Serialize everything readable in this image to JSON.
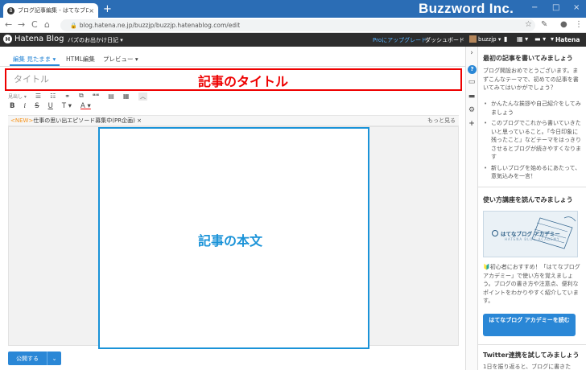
{
  "browser": {
    "tab_title": "ブログ記事編集 - はてなブログ",
    "tab_close": "×",
    "new_tab": "+",
    "favicon": "B",
    "brand": "Buzzword Inc.",
    "url": "blog.hatena.ne.jp/buzzjp/buzzjp.hatenablog.com/edit",
    "window_controls": [
      "−",
      "□",
      "×"
    ],
    "nav": {
      "back": "←",
      "forward": "→",
      "reload": "C",
      "home": "⌂"
    },
    "addr_icons": {
      "star": "☆",
      "extension": "✎",
      "account": "●",
      "menu": "⋮"
    }
  },
  "hatena_bar": {
    "logo": "Hatena Blog",
    "logo_mark": "H",
    "blog_name": "バズのお出かけ日記 ▾",
    "pro_link": "Proにアップグレード",
    "dashboard": "ダッシュボード",
    "user": "buzzjp ▾",
    "icons": {
      "bookmark": "▮",
      "apps": "▦ ▾",
      "notify": "▬ ▾",
      "more": "▾"
    },
    "right_logo": "Hatena"
  },
  "editor": {
    "tabs": {
      "edit": "編集 見たまま ▾",
      "html": "HTML編集",
      "preview": "プレビュー ▾"
    },
    "title_placeholder": "タイトル",
    "title_annotation": "記事のタイトル",
    "toolbar1": [
      "見出し ▾",
      "☰",
      "☷",
      "⚭",
      "⧉",
      "❝❝",
      "▤",
      "▦",
      "⋯"
    ],
    "collapse": "︿",
    "toolbar2": [
      "B",
      "i",
      "S",
      "U",
      "T ▾",
      "A ▾"
    ],
    "ticker": {
      "tag": "<NEW>",
      "text": "仕事の思い出エピソード募集中(PR企画) ×",
      "more": "もっと見る"
    },
    "body_annotation": "記事の本文",
    "publish": "公開する",
    "publish_arrow": "⌄"
  },
  "side_icons": {
    "collapse": "›",
    "help": "?",
    "chat": "▭",
    "folder": "▬",
    "settings": "⚙",
    "add": "+"
  },
  "panel": {
    "s1_heading": "最初の記事を書いてみましょう",
    "s1_text": "ブログ開設おめでとうございます。まずこんなテーマで、初めての記事を書いてみてはいかがでしょう？",
    "s1_items": [
      "かんたんな挨拶や自己紹介をしてみましょう",
      "このブログでこれから書いていきたいと思っていること。「今日印象に残ったこと」などテーマをはっきりさせるとブログが続きやすくなります",
      "新しいブログを始めるにあたって、意気込みを一言！"
    ],
    "s2_heading": "使い方講座を読んでみましょう",
    "academy_name": "はてなブログ アカデミー",
    "academy_sub": "HATENA BLOG ACADEMY",
    "s2_text": "🔰初心者におすすめ！「はてなブログ アカデミー」で使い方を覚えましょう。ブログの書き方や注意点、便利なポイントをわかりやすく紹介しています。",
    "s2_button": "はてなブログ アカデミーを読む",
    "s3_heading": "Twitter連携を試してみましょう",
    "s3_text": "1日を振り返ると、ブログに書きた"
  }
}
